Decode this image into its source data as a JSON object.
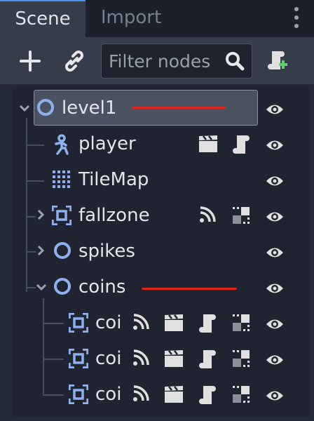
{
  "tabs": {
    "scene": "Scene",
    "import": "Import"
  },
  "toolbar": {
    "filter_placeholder": "Filter nodes"
  },
  "tree": {
    "rows": [
      {
        "label": "level1",
        "icon": "node-circle-icon",
        "expanded": true,
        "selected": true
      },
      {
        "label": "player",
        "icon": "kinematic-body-icon",
        "badges": [
          "scene-icon",
          "script-icon"
        ]
      },
      {
        "label": "TileMap",
        "icon": "tilemap-icon"
      },
      {
        "label": "fallzone",
        "icon": "area-icon",
        "collapsed": true,
        "badges": [
          "signal-icon",
          "groups-icon"
        ]
      },
      {
        "label": "spikes",
        "icon": "node-circle-icon",
        "collapsed": true
      },
      {
        "label": "coins",
        "icon": "node-circle-icon",
        "expanded": true
      },
      {
        "label": "coi",
        "icon": "area-icon",
        "badges": [
          "signal-icon",
          "scene-icon",
          "script-icon",
          "groups-icon"
        ]
      },
      {
        "label": "coi",
        "icon": "area-icon",
        "badges": [
          "signal-icon",
          "scene-icon",
          "script-icon",
          "groups-icon"
        ]
      },
      {
        "label": "coi",
        "icon": "area-icon",
        "badges": [
          "signal-icon",
          "scene-icon",
          "script-icon",
          "groups-icon"
        ]
      }
    ]
  },
  "colors": {
    "accent_blue": "#8fb0f0",
    "icon_gray": "#e0e0e0",
    "annotation_red": "#e0241a",
    "panel_bg": "#232935"
  }
}
